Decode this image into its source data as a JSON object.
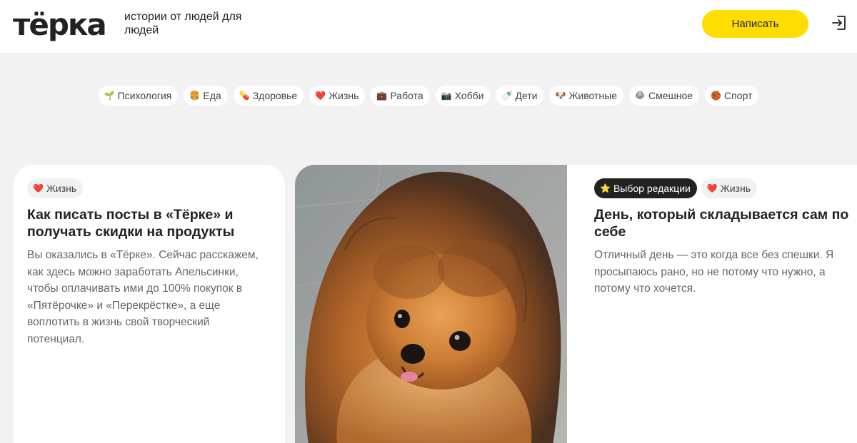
{
  "header": {
    "logo": "тёрка",
    "tagline": "истории от людей для людей",
    "write_button": "Написать",
    "login_icon": "login-icon"
  },
  "categories": [
    {
      "emoji": "🌱",
      "label": "Психология"
    },
    {
      "emoji": "🍔",
      "label": "Еда"
    },
    {
      "emoji": "💊",
      "label": "Здоровье"
    },
    {
      "emoji": "❤️",
      "label": "Жизнь"
    },
    {
      "emoji": "💼",
      "label": "Работа"
    },
    {
      "emoji": "📷",
      "label": "Хобби"
    },
    {
      "emoji": "🍼",
      "label": "Дети"
    },
    {
      "emoji": "🐶",
      "label": "Животные"
    },
    {
      "emoji": "😂",
      "label": "Смешное"
    },
    {
      "emoji": "🏀",
      "label": "Спорт"
    }
  ],
  "cards": [
    {
      "tags": [
        {
          "emoji": "❤️",
          "label": "Жизнь"
        }
      ],
      "title_lines": [
        "Как писать посты в «Тёрке» и",
        "получать скидки на продукты"
      ],
      "excerpt_lines": [
        "Вы оказались в «Тёрке». Сейчас расскажем,",
        "как здесь можно заработать Апельсинки,",
        "чтобы оплачивать ими до 100% покупок в",
        "«Пятёрочке» и «Перекрёстке», а еще",
        "воплотить в жизнь свой творческий",
        "потенциал."
      ]
    },
    {
      "photo": "pomeranian-dog-photo",
      "tags": [
        {
          "emoji": "⭐",
          "label": "Выбор редакции"
        },
        {
          "emoji": "❤️",
          "label": "Жизнь"
        }
      ],
      "title_lines": [
        "День, который складывается сам по",
        "себе"
      ],
      "excerpt_lines": [
        "Отличный день — это когда все без спешки. Я",
        "просыпаюсь рано, но не потому что нужно, а",
        "потому что хочется."
      ]
    }
  ],
  "colors": {
    "accent": "#ffdd00",
    "background": "#f2f2f2",
    "text": "#222222",
    "muted": "#666666"
  }
}
